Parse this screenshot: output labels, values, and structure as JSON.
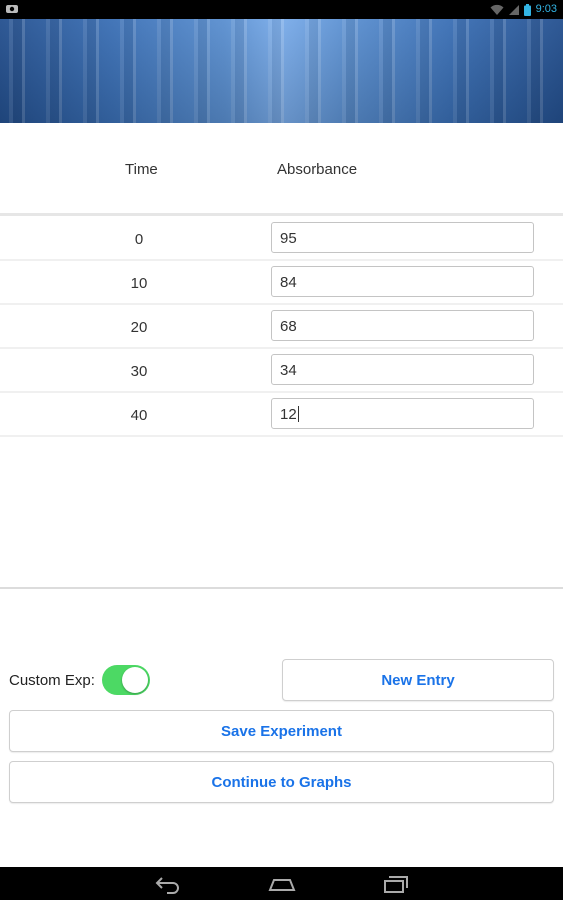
{
  "status_bar": {
    "time": "9:03",
    "icons": [
      "notification-icon",
      "wifi-icon",
      "signal-icon",
      "battery-icon"
    ]
  },
  "table": {
    "headers": {
      "time": "Time",
      "absorbance": "Absorbance"
    },
    "rows": [
      {
        "time": "0",
        "absorbance": "95"
      },
      {
        "time": "10",
        "absorbance": "84"
      },
      {
        "time": "20",
        "absorbance": "68"
      },
      {
        "time": "30",
        "absorbance": "34"
      },
      {
        "time": "40",
        "absorbance": "12"
      }
    ]
  },
  "controls": {
    "custom_exp_label": "Custom Exp:",
    "custom_exp_on": true,
    "new_entry_label": "New Entry",
    "save_label": "Save Experiment",
    "continue_label": "Continue to Graphs"
  },
  "colors": {
    "accent": "#1a73e8",
    "toggle_on": "#4cd964",
    "status_icons": "#33b5e5"
  },
  "nav_bar": {
    "icons": [
      "back-icon",
      "home-icon",
      "recent-apps-icon"
    ]
  }
}
